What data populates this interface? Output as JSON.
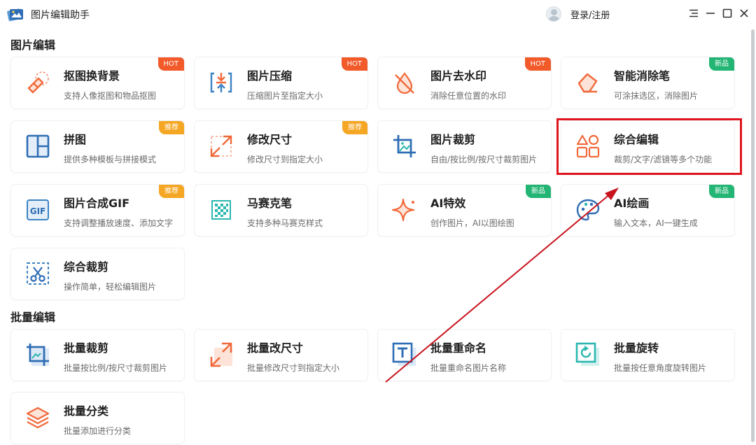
{
  "app": {
    "title": "图片编辑助手",
    "login": "登录/注册"
  },
  "colors": {
    "accent_orange": "#f0693a",
    "accent_blue": "#3b82c4",
    "accent_teal": "#2bb7b0",
    "hot": "#f25a2a",
    "new": "#22b573",
    "recommend": "#f5a623",
    "highlight": "#e0141e"
  },
  "sections": [
    {
      "title": "图片编辑",
      "cards": [
        {
          "title": "抠图换背景",
          "desc": "支持人像抠图和物品抠图",
          "badge": "HOT",
          "icon": "eraser-icon"
        },
        {
          "title": "图片压缩",
          "desc": "压缩图片至指定大小",
          "badge": "HOT",
          "icon": "compress-icon"
        },
        {
          "title": "图片去水印",
          "desc": "消除任意位置的水印",
          "badge": "HOT",
          "icon": "watermark-remove-icon"
        },
        {
          "title": "智能消除笔",
          "desc": "可涂抹选区，消除图片",
          "badge": "新品",
          "icon": "smart-eraser-icon"
        },
        {
          "title": "拼图",
          "desc": "提供多种模板与拼接模式",
          "badge": "推荐",
          "icon": "collage-icon"
        },
        {
          "title": "修改尺寸",
          "desc": "修改尺寸到指定大小",
          "badge": "推荐",
          "icon": "resize-icon"
        },
        {
          "title": "图片裁剪",
          "desc": "自由/按比例/按尺寸裁剪图片",
          "badge": "",
          "icon": "crop-icon"
        },
        {
          "title": "综合编辑",
          "desc": "裁剪/文字/滤镜等多个功能",
          "badge": "",
          "icon": "shapes-icon"
        },
        {
          "title": "图片合成GIF",
          "desc": "支持调整播放速度、添加文字",
          "badge": "推荐",
          "icon": "gif-icon"
        },
        {
          "title": "马赛克笔",
          "desc": "支持多种马赛克样式",
          "badge": "",
          "icon": "mosaic-icon"
        },
        {
          "title": "AI特效",
          "desc": "创作图片，AI以图绘图",
          "badge": "新品",
          "icon": "sparkle-icon"
        },
        {
          "title": "AI绘画",
          "desc": "输入文本，AI一键生成",
          "badge": "新品",
          "icon": "palette-icon"
        },
        {
          "title": "综合裁剪",
          "desc": "操作简单，轻松编辑图片",
          "badge": "",
          "icon": "scissors-icon"
        }
      ]
    },
    {
      "title": "批量编辑",
      "cards": [
        {
          "title": "批量裁剪",
          "desc": "批量按比例/按尺寸裁剪图片",
          "badge": "",
          "icon": "batch-crop-icon"
        },
        {
          "title": "批量改尺寸",
          "desc": "批量修改尺寸到指定大小",
          "badge": "",
          "icon": "batch-resize-icon"
        },
        {
          "title": "批量重命名",
          "desc": "批量重命名图片名称",
          "badge": "",
          "icon": "batch-rename-icon"
        },
        {
          "title": "批量旋转",
          "desc": "批量按任意角度旋转图片",
          "badge": "",
          "icon": "batch-rotate-icon"
        },
        {
          "title": "批量分类",
          "desc": "批量添加进行分类",
          "badge": "",
          "icon": "layers-icon"
        }
      ]
    }
  ]
}
